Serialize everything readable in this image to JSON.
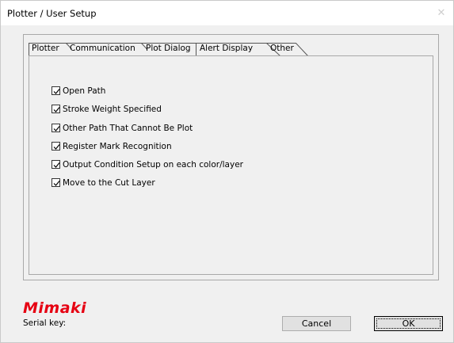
{
  "window": {
    "title": "Plotter / User Setup",
    "close_glyph": "✕"
  },
  "tabs": [
    {
      "label": "Plotter",
      "active": false
    },
    {
      "label": "Communication",
      "active": false
    },
    {
      "label": "Plot Dialog",
      "active": false
    },
    {
      "label": "Alert Display",
      "active": true
    },
    {
      "label": "Other",
      "active": false
    }
  ],
  "alerts": [
    {
      "label": "Open Path",
      "checked": true
    },
    {
      "label": "Stroke Weight Specified",
      "checked": true
    },
    {
      "label": "Other Path That Cannot Be Plot",
      "checked": true
    },
    {
      "label": "Register Mark Recognition",
      "checked": true
    },
    {
      "label": "Output Condition Setup on each color/layer",
      "checked": true
    },
    {
      "label": "Move to the Cut Layer",
      "checked": true
    }
  ],
  "footer": {
    "logo_text": "Mimaki",
    "logo_color": "#e60012",
    "serial_label": "Serial key:",
    "cancel_label": "Cancel",
    "ok_label": "OK"
  }
}
